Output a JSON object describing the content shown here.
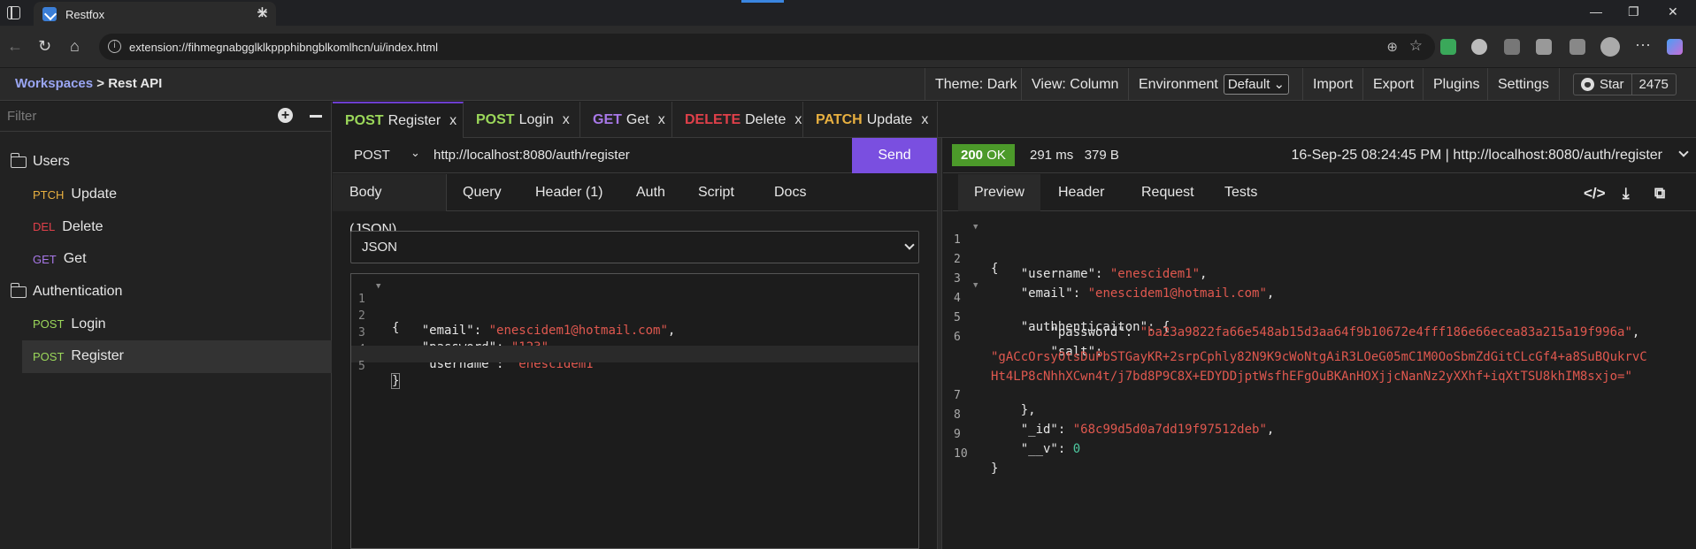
{
  "browser": {
    "tab_title": "Restfox",
    "address": "extension://fihmegnabgglklkppphibngblkomlhcn/ui/index.html"
  },
  "header": {
    "workspaces_link": "Workspaces",
    "separator": ">",
    "workspace_name": "Rest API",
    "theme": "Theme: Dark",
    "view": "View: Column",
    "environment_label": "Environment",
    "environment_value": "Default",
    "import": "Import",
    "export": "Export",
    "plugins": "Plugins",
    "settings": "Settings",
    "star_label": "Star",
    "star_count": "2475"
  },
  "sidebar": {
    "filter_placeholder": "Filter",
    "tree": [
      {
        "type": "folder",
        "label": "Users"
      },
      {
        "type": "request",
        "method": "PTCH",
        "label": "Update"
      },
      {
        "type": "request",
        "method": "DEL",
        "label": "Delete"
      },
      {
        "type": "request",
        "method": "GET",
        "label": "Get"
      },
      {
        "type": "folder",
        "label": "Authentication"
      },
      {
        "type": "request",
        "method": "POST",
        "label": "Login"
      },
      {
        "type": "request",
        "method": "POST",
        "label": "Register",
        "selected": true
      }
    ]
  },
  "request_tabs": [
    {
      "method": "POST",
      "label": "Register",
      "close": "x"
    },
    {
      "method": "POST",
      "label": "Login",
      "close": "x"
    },
    {
      "method": "GET",
      "label": "Get",
      "close": "x"
    },
    {
      "method": "DELETE",
      "label": "Delete",
      "close": "x"
    },
    {
      "method": "PATCH",
      "label": "Update",
      "close": "x"
    }
  ],
  "request": {
    "method": "POST",
    "url": "http://localhost:8080/auth/register",
    "send_label": "Send",
    "tabs": [
      "Body (JSON)",
      "Query",
      "Header (1)",
      "Auth",
      "Script",
      "Docs"
    ],
    "body_type": "JSON",
    "body_lines": [
      {
        "n": "1",
        "text": "{"
      },
      {
        "n": "2",
        "key": "\"email\"",
        "value": "\"enescidem1@hotmail.com\"",
        "trail": ","
      },
      {
        "n": "3",
        "key": "\"password\"",
        "value": "\"123\"",
        "trail": ","
      },
      {
        "n": "4",
        "key": "\"username\"",
        "value": "\"enescidem1\"",
        "trail": ""
      },
      {
        "n": "5",
        "text": "}"
      }
    ]
  },
  "response": {
    "status_code": "200",
    "status_text": "OK",
    "time": "291 ms",
    "size": "379 B",
    "info": "16-Sep-25 08:24:45 PM | http://localhost:8080/auth/register",
    "tabs": [
      "Preview",
      "Header",
      "Request",
      "Tests"
    ],
    "lines": [
      {
        "n": "1",
        "text": "{"
      },
      {
        "n": "2",
        "key": "\"username\"",
        "value": "\"enescidem1\"",
        "trail": ","
      },
      {
        "n": "3",
        "key": "\"email\"",
        "value": "\"enescidem1@hotmail.com\"",
        "trail": ","
      },
      {
        "n": "4",
        "key": "\"authhenticaiton\"",
        "text": ": {"
      },
      {
        "n": "5",
        "key": "\"password\"",
        "value": "\"ba23a9822fa66e548ab15d3aa64f9b10672e4fff186e66ecea83a215a19f996a\"",
        "trail": ","
      },
      {
        "n": "6",
        "key": "\"salt\"",
        "text": ":"
      },
      {
        "n": "",
        "value": "\"gACcOrsyOtsDuPbSTGayKR+2srpCphly82N9K9cWoNtgAiR3LOeG05mC1M0OoSbmZdGitCLcGf4+a8SuBQukrvC"
      },
      {
        "n": "",
        "value": "Ht4LP8cNhhXCwn4t/j7bd8P9C8X+EDYDDjptWsfhEFgOuBKAnHOXjjcNanNz2yXXhf+iqXtTSU8khIM8sxjo=\""
      },
      {
        "n": "7",
        "text": "},"
      },
      {
        "n": "8",
        "key": "\"_id\"",
        "value": "\"68c99d5d0a7dd19f97512deb\"",
        "trail": ","
      },
      {
        "n": "9",
        "key": "\"__v\"",
        "number": "0"
      },
      {
        "n": "10",
        "text": "}"
      }
    ]
  },
  "colors": {
    "accent": "#7a4fe0",
    "post": "#9bd75a",
    "delete": "#e0404a",
    "get": "#a878e8",
    "patch": "#e8b040",
    "status_ok": "#4c9a2a",
    "string": "#e0584f",
    "number": "#4ec9a0"
  }
}
